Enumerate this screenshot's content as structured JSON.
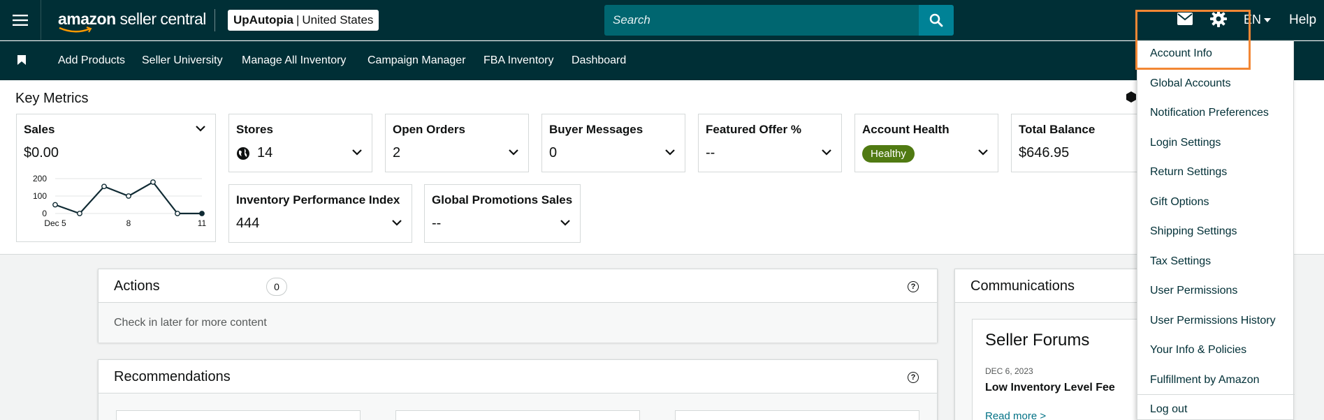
{
  "header": {
    "logo_brand": "amazon",
    "logo_product": "seller central",
    "store_name": "UpAutopia",
    "store_sep": "|",
    "store_region": "United States",
    "search_placeholder": "Search",
    "language": "EN",
    "help": "Help"
  },
  "nav": {
    "items": [
      "Add Products",
      "Seller University",
      "Manage All Inventory",
      "Campaign Manager",
      "FBA Inventory",
      "Dashboard"
    ]
  },
  "key_metrics": {
    "title": "Key Metrics",
    "sales": {
      "label": "Sales",
      "value": "$0.00"
    },
    "cards": [
      {
        "label": "Stores",
        "value": "14"
      },
      {
        "label": "Open Orders",
        "value": "2"
      },
      {
        "label": "Buyer Messages",
        "value": "0"
      },
      {
        "label": "Featured Offer %",
        "value": "--"
      },
      {
        "label": "Account Health",
        "value": "Healthy"
      },
      {
        "label": "Total Balance",
        "value": "$646.95"
      },
      {
        "label": "Inventory Performance Index",
        "value": "444"
      },
      {
        "label": "Global Promotions Sales",
        "value": "--"
      }
    ]
  },
  "chart_data": {
    "type": "line",
    "x": [
      5,
      6,
      7,
      8,
      9,
      10,
      11
    ],
    "values": [
      50,
      0,
      155,
      100,
      180,
      0,
      0
    ],
    "xticks": [
      "Dec 5",
      "8",
      "11"
    ],
    "yticks": [
      "200",
      "100",
      "0"
    ],
    "ylim": [
      0,
      200
    ],
    "grid": true
  },
  "panels": {
    "actions": {
      "title": "Actions",
      "count": "0",
      "empty_text": "Check in later for more content"
    },
    "recommendations": {
      "title": "Recommendations"
    },
    "communications": {
      "title": "Communications"
    },
    "forums": {
      "title": "Seller Forums",
      "date": "DEC 6, 2023",
      "headline": "Low Inventory Level Fee",
      "link": "Read more >"
    }
  },
  "settings_menu": {
    "items": [
      "Account Info",
      "Global Accounts",
      "Notification Preferences",
      "Login Settings",
      "Return Settings",
      "Gift Options",
      "Shipping Settings",
      "Tax Settings",
      "User Permissions",
      "User Permissions History",
      "Your Info & Policies",
      "Fulfillment by Amazon"
    ],
    "logout": "Log out"
  },
  "colors": {
    "header_bg": "#002f36",
    "search_bg": "#006670",
    "search_btn": "#008296",
    "healthy_badge": "#507a12",
    "highlight": "#f28734"
  }
}
